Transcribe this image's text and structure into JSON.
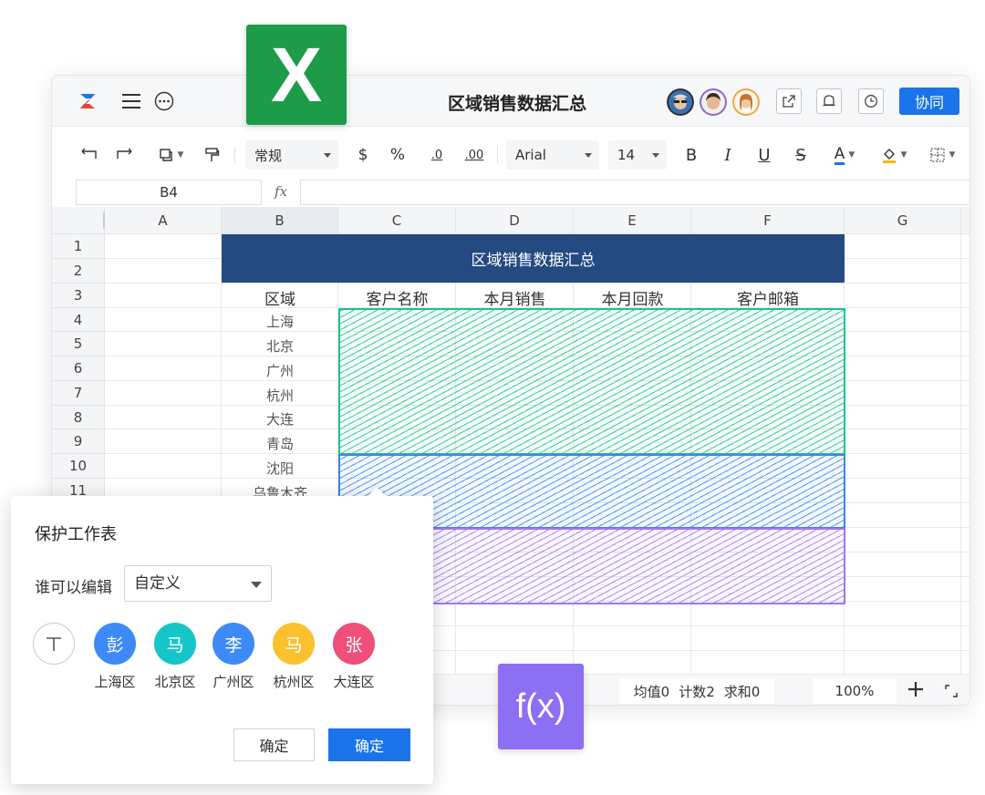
{
  "app": {
    "title": "区域销售数据汇总",
    "collab_label": "协同"
  },
  "toolbar": {
    "number_format": "常规",
    "currency_symbol": "$",
    "percent_symbol": "%",
    "decrease_decimal": ".0",
    "increase_decimal": ".00",
    "font_name": "Arial",
    "font_size": "14",
    "bold": "B",
    "italic": "I",
    "underline": "U",
    "strike": "S",
    "font_color": "A"
  },
  "formula_bar": {
    "name_box": "B4",
    "fx_label": "fx",
    "formula": ""
  },
  "sheet": {
    "columns": [
      "A",
      "B",
      "C",
      "D",
      "E",
      "F",
      "G"
    ],
    "rows": [
      "1",
      "2",
      "3",
      "4",
      "5",
      "6",
      "7",
      "8",
      "9",
      "10",
      "11"
    ],
    "merged_title": "区域销售数据汇总",
    "headers": [
      "区域",
      "客户名称",
      "本月销售",
      "本月回款",
      "客户邮箱"
    ],
    "regions": [
      "上海",
      "北京",
      "广州",
      "杭州",
      "大连",
      "青岛",
      "沈阳",
      "乌鲁木齐"
    ]
  },
  "status": {
    "average": "均值0",
    "count": "计数2",
    "sum": "求和0",
    "zoom": "100%"
  },
  "badges": {
    "excel": "X",
    "fx": "f(x)"
  },
  "dialog": {
    "title": "保护工作表",
    "who_can_edit_label": "谁可以编辑",
    "who_can_edit_value": "自定义",
    "users": [
      {
        "name": "彭",
        "region": "上海区",
        "color": "#3d8af7"
      },
      {
        "name": "马",
        "region": "北京区",
        "color": "#15c6c9"
      },
      {
        "name": "李",
        "region": "广州区",
        "color": "#3d8af7"
      },
      {
        "name": "马",
        "region": "杭州区",
        "color": "#fbc12c"
      },
      {
        "name": "张",
        "region": "大连区",
        "color": "#f04f7a"
      }
    ],
    "cancel_label": "确定",
    "confirm_label": "确定"
  },
  "colors": {
    "accent": "#1a73e8",
    "title_fill": "#244a82",
    "range_green": "#1fc28c",
    "range_blue": "#3b86f0",
    "range_purple": "#a176f0",
    "excel_green": "#1d9b49",
    "fx_purple": "#8c6ff2"
  }
}
